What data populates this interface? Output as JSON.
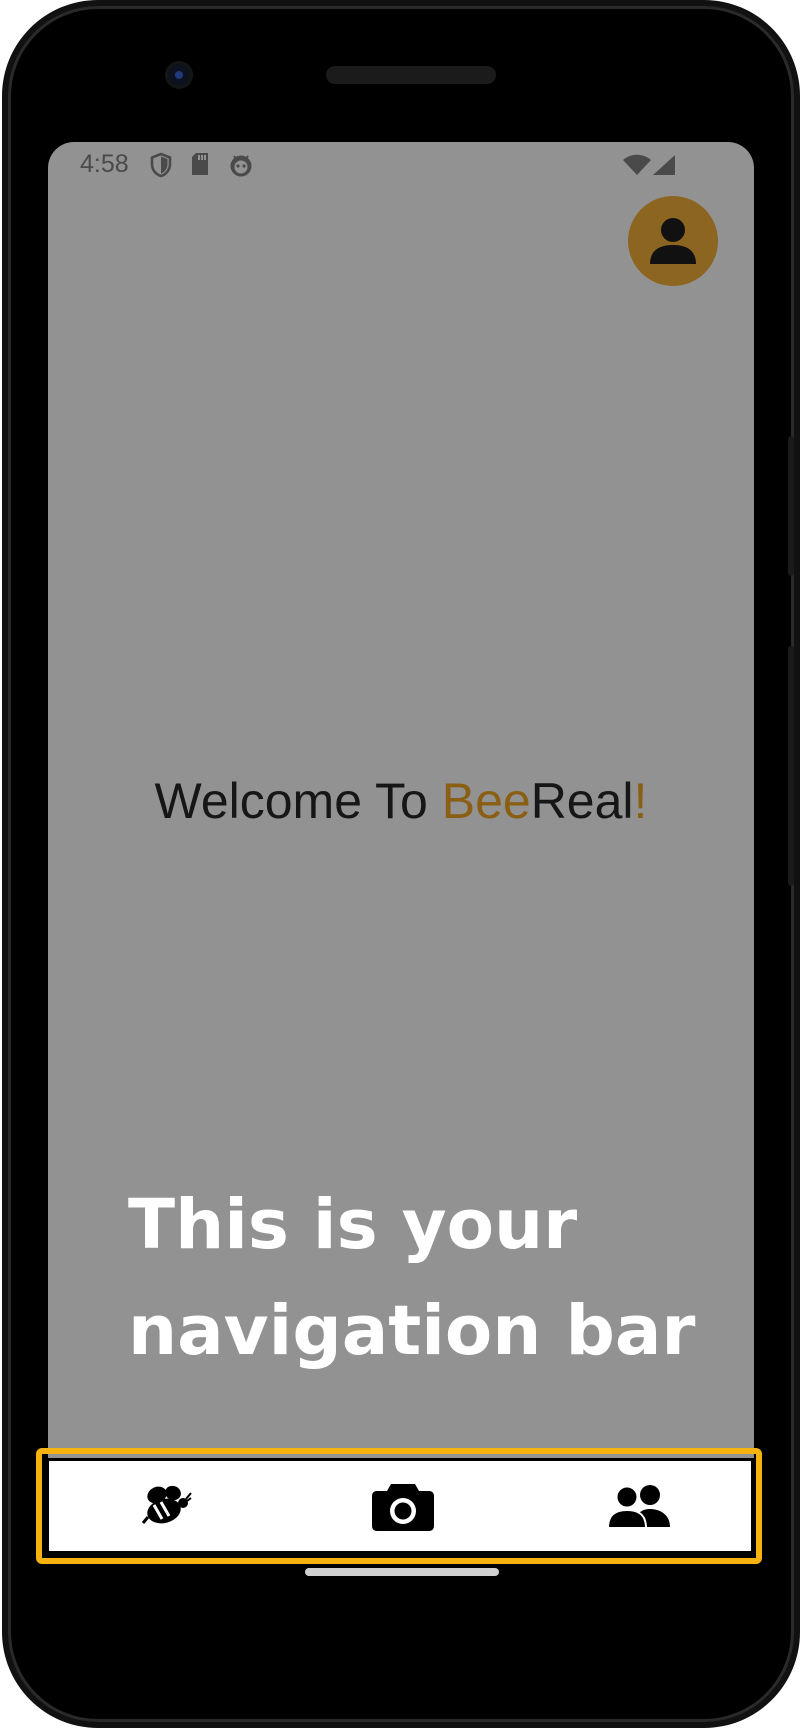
{
  "status_bar": {
    "time": "4:58",
    "left_icons": [
      "shield-icon",
      "sd-card-icon",
      "android-face-icon"
    ],
    "right_icons": [
      "wifi-icon",
      "cell-signal-icon"
    ]
  },
  "profile": {
    "icon": "person-icon",
    "color": "#8c6520"
  },
  "welcome": {
    "prefix": "Welcome To ",
    "brand_bee": "Bee",
    "brand_real": "Real",
    "exclaim": "!",
    "accent_color": "#8a5f13"
  },
  "tutorial": {
    "message": "This is your navigation bar",
    "highlight_color": "#f6b20f"
  },
  "nav": {
    "items": [
      {
        "icon": "bee-icon"
      },
      {
        "icon": "camera-icon"
      },
      {
        "icon": "users-icon"
      }
    ]
  }
}
